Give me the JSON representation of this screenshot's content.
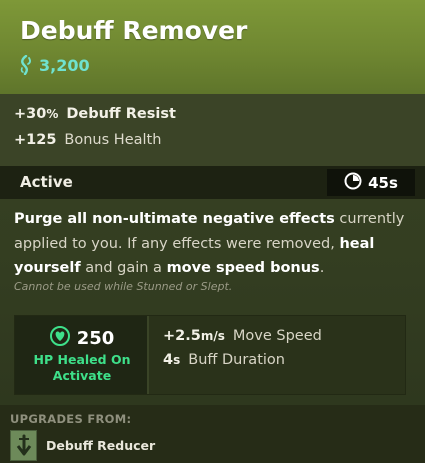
{
  "item": {
    "title": "Debuff Remover",
    "cost": "3,200",
    "cost_icon": "souls-icon"
  },
  "stats": [
    {
      "value": "+30",
      "unit": "%",
      "label": "Debuff Resist",
      "label_bold": true
    },
    {
      "value": "+125",
      "unit": "",
      "label": "Bonus Health",
      "label_bold": false
    }
  ],
  "active": {
    "label": "Active",
    "cooldown_icon": "cooldown-icon",
    "cooldown": "45s"
  },
  "description": {
    "p1": "Purge all non-ultimate negative effects",
    "p2": " currently applied to you. If any effects were removed, ",
    "p3": "heal yourself",
    "p4": " and gain a ",
    "p5": "move speed bonus",
    "p6": ".",
    "note": "Cannot be used while Stunned or Slept."
  },
  "heal": {
    "icon": "heal-icon",
    "value": "250",
    "label_line1": "HP Healed On",
    "label_line2": "Activate"
  },
  "bonuses": [
    {
      "value": "+2.5",
      "unit": "m/s",
      "label": "Move Speed"
    },
    {
      "value": "4",
      "unit": "s",
      "label": "Buff Duration"
    }
  ],
  "upgrades": {
    "title": "UPGRADES FROM:",
    "item_name": "Debuff Reducer",
    "item_icon": "debuff-reducer-icon"
  },
  "colors": {
    "header_green": "#7e9838",
    "cost_teal": "#6fe2d0",
    "heal_green": "#3ee08a"
  }
}
